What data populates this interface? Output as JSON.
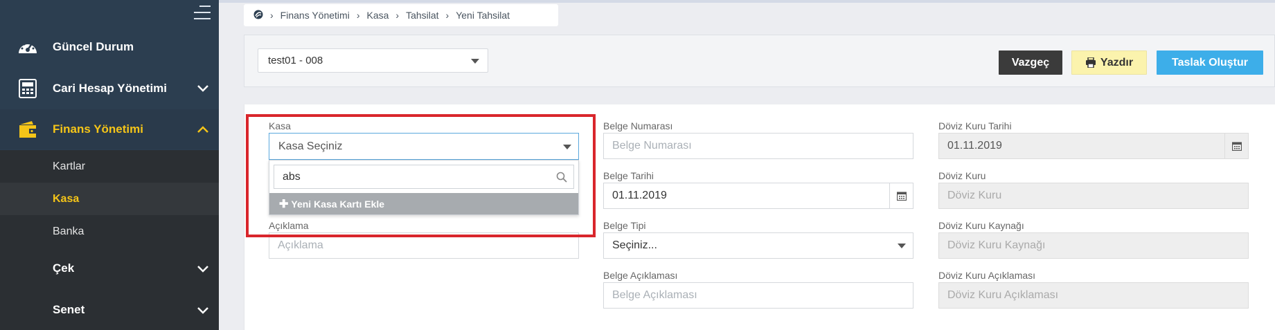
{
  "sidebar": {
    "items": [
      {
        "label": "Güncel Durum",
        "icon": "speedometer-icon"
      },
      {
        "label": "Cari Hesap Yönetimi",
        "icon": "calculator-icon"
      },
      {
        "label": "Finans Yönetimi",
        "icon": "wallet-icon"
      }
    ],
    "subitems": [
      "Kartlar",
      "Kasa",
      "Banka"
    ],
    "subgroups": [
      "Çek",
      "Senet"
    ]
  },
  "breadcrumb": [
    "Finans Yönetimi",
    "Kasa",
    "Tahsilat",
    "Yeni Tahsilat"
  ],
  "header": {
    "branch_select": "test01 - 008",
    "cancel_label": "Vazgeç",
    "print_label": "Yazdır",
    "draft_label": "Taslak Oluştur"
  },
  "form": {
    "kasa_label": "Kasa",
    "kasa_placeholder": "Kasa Seçiniz",
    "kasa_search_value": "abs",
    "kasa_add_label": "Yeni Kasa Kartı Ekle",
    "aciklama_label": "Açıklama",
    "aciklama_placeholder": "Açıklama",
    "belge_no_label": "Belge Numarası",
    "belge_no_placeholder": "Belge Numarası",
    "belge_tarihi_label": "Belge Tarihi",
    "belge_tarihi_value": "01.11.2019",
    "belge_tipi_label": "Belge Tipi",
    "belge_tipi_value": "Seçiniz...",
    "belge_aciklama_label": "Belge Açıklaması",
    "belge_aciklama_placeholder": "Belge Açıklaması",
    "doviz_tarihi_label": "Döviz Kuru Tarihi",
    "doviz_tarihi_value": "01.11.2019",
    "doviz_kuru_label": "Döviz Kuru",
    "doviz_kuru_placeholder": "Döviz Kuru",
    "doviz_kaynak_label": "Döviz Kuru Kaynağı",
    "doviz_kaynak_placeholder": "Döviz Kuru Kaynağı",
    "doviz_aciklama_label": "Döviz Kuru Açıklaması",
    "doviz_aciklama_placeholder": "Döviz Kuru Açıklaması"
  },
  "colors": {
    "sidebar_bg": "#2c3e50",
    "active_accent": "#f5c518",
    "highlight_border": "#d9262c",
    "draft_button": "#3daee9",
    "print_button": "#fbf3ad"
  }
}
